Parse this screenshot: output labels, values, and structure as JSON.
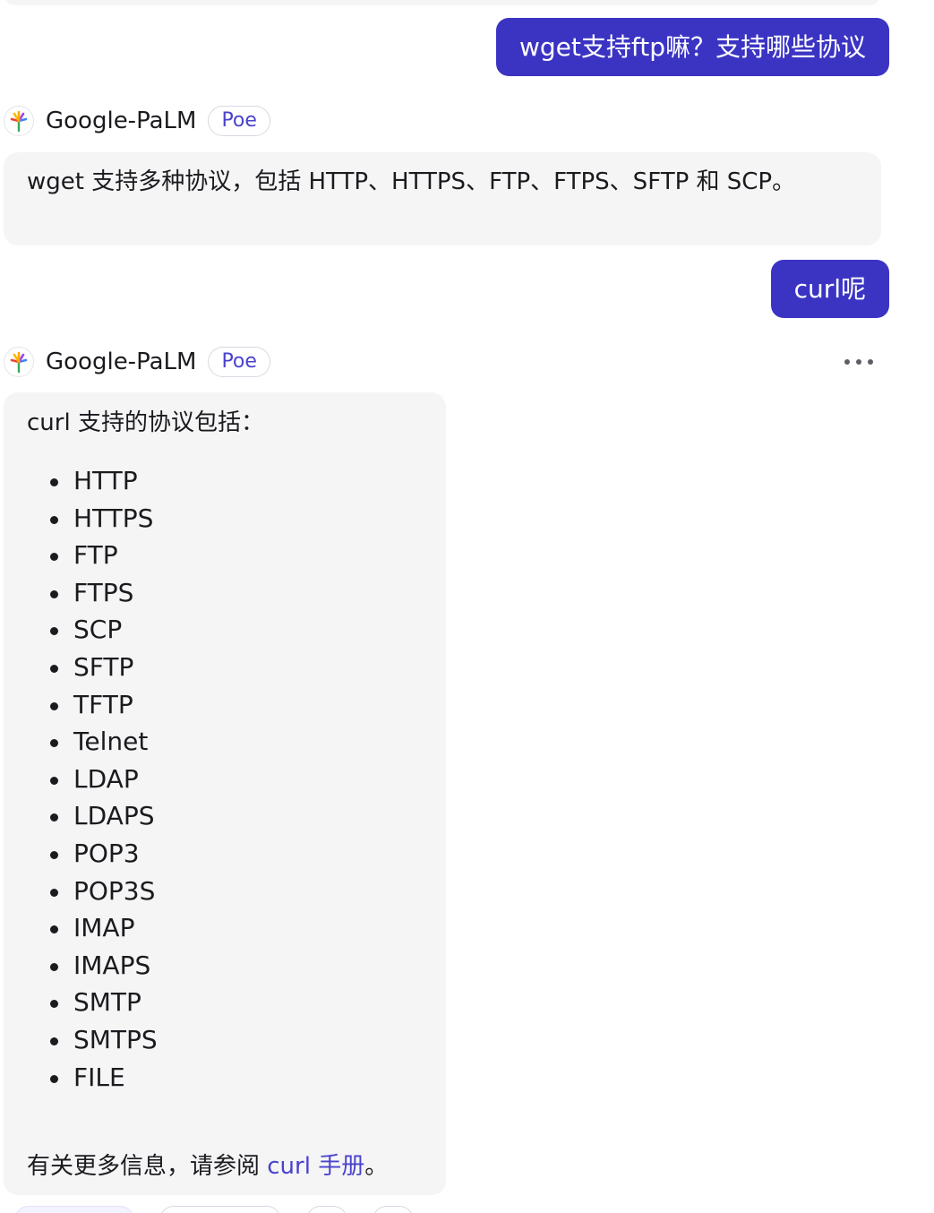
{
  "conversation": {
    "user_message_1": "wget支持ftp嘛？支持哪些协议",
    "bot_reply_1": {
      "bot_name": "Google-PaLM",
      "badge": "Poe",
      "text": "wget 支持多种协议，包括 HTTP、HTTPS、FTP、FTPS、SFTP 和 SCP。"
    },
    "user_message_2": "curl呢",
    "bot_reply_2": {
      "bot_name": "Google-PaLM",
      "badge": "Poe",
      "intro": "curl 支持的协议包括：",
      "protocols": [
        "HTTP",
        "HTTPS",
        "FTP",
        "FTPS",
        "SCP",
        "SFTP",
        "TFTP",
        "Telnet",
        "LDAP",
        "LDAPS",
        "POP3",
        "POP3S",
        "IMAP",
        "IMAPS",
        "SMTP",
        "SMTPS",
        "FILE"
      ],
      "footer_prefix": "有关更多信息，请参阅 ",
      "footer_link": "curl 手册",
      "footer_suffix": "。"
    }
  },
  "icons": {
    "bot_avatar": "palm-tree-icon",
    "more_menu": "more-horizontal-icon"
  },
  "colors": {
    "user_bubble": "#3b34c3",
    "bot_bubble": "#f5f5f6",
    "accent": "#4a43cc"
  }
}
